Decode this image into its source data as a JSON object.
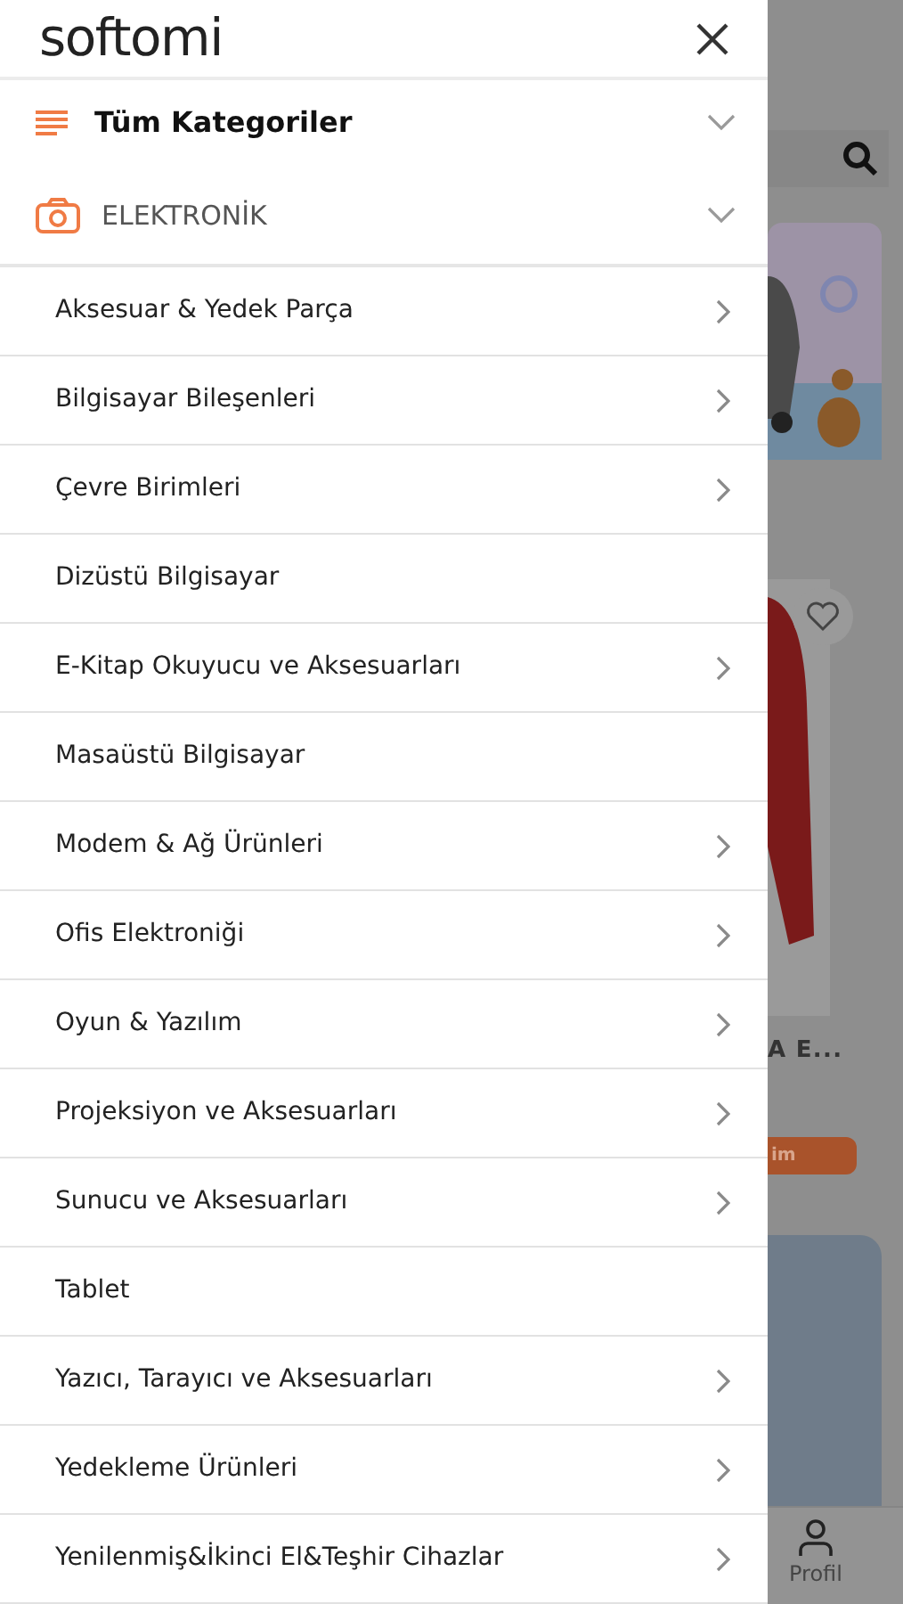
{
  "drawer": {
    "logo": "softomi",
    "sections": [
      {
        "kind": "all",
        "label": "Tüm Kategoriler"
      },
      {
        "kind": "category",
        "label": "ELEKTRONİK"
      }
    ],
    "items": [
      {
        "label": "Aksesuar & Yedek Parça",
        "has_children": true
      },
      {
        "label": "Bilgisayar Bileşenleri",
        "has_children": true
      },
      {
        "label": "Çevre Birimleri",
        "has_children": true
      },
      {
        "label": "Dizüstü Bilgisayar",
        "has_children": false
      },
      {
        "label": "E-Kitap Okuyucu ve Aksesuarları",
        "has_children": true
      },
      {
        "label": "Masaüstü Bilgisayar",
        "has_children": false
      },
      {
        "label": "Modem & Ağ Ürünleri",
        "has_children": true
      },
      {
        "label": "Ofis Elektroniği",
        "has_children": true
      },
      {
        "label": "Oyun & Yazılım",
        "has_children": true
      },
      {
        "label": "Projeksiyon ve Aksesuarları",
        "has_children": true
      },
      {
        "label": "Sunucu ve Aksesuarları",
        "has_children": true
      },
      {
        "label": "Tablet",
        "has_children": false
      },
      {
        "label": "Yazıcı, Tarayıcı ve Aksesuarları",
        "has_children": true
      },
      {
        "label": "Yedekleme Ürünleri",
        "has_children": true
      },
      {
        "label": "Yenilenmiş&İkinci El&Teşhir Cihazlar",
        "has_children": true
      }
    ]
  },
  "background_page": {
    "product_title": "A E...",
    "button": "im",
    "nav_label": "Profil"
  }
}
